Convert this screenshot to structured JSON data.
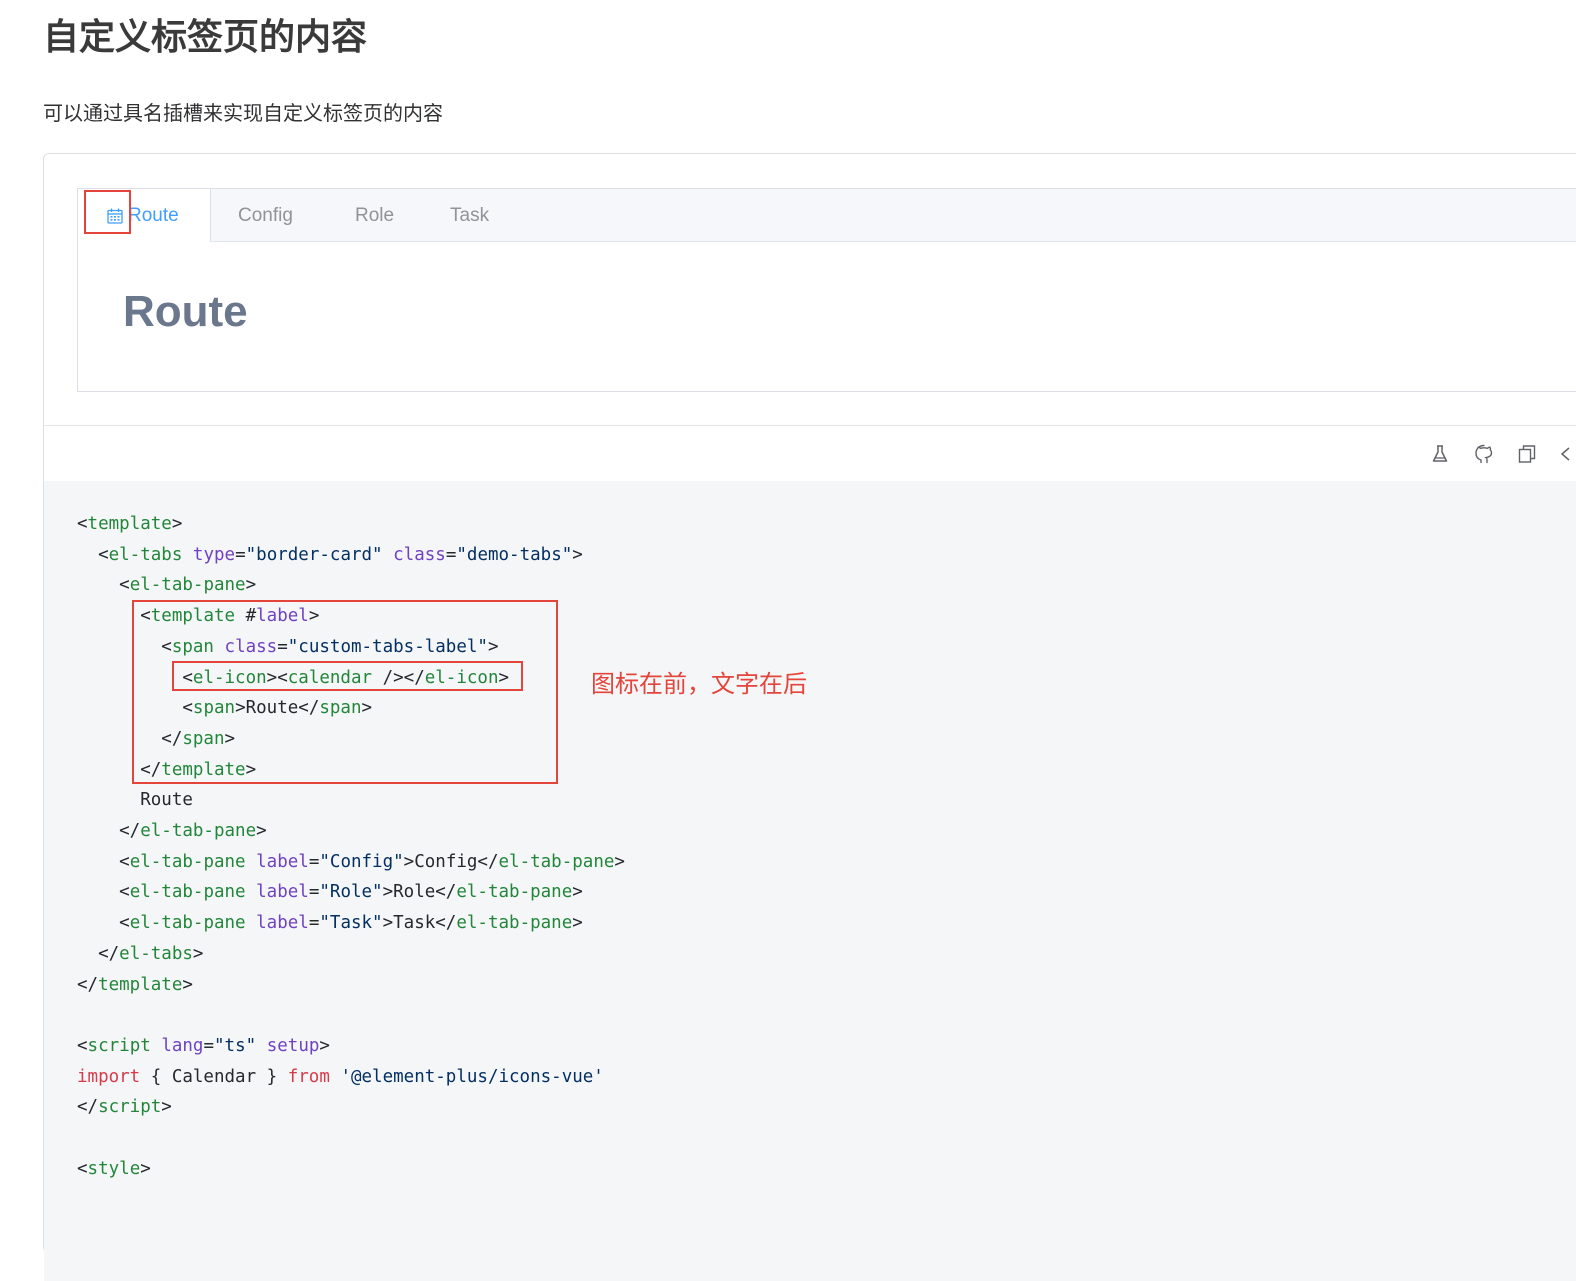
{
  "page": {
    "title": "自定义标签页的内容",
    "description": "可以通过具名插槽来实现自定义标签页的内容"
  },
  "tabs": {
    "items": [
      {
        "label": "Route",
        "active": true,
        "icon": "calendar-icon"
      },
      {
        "label": "Config",
        "active": false
      },
      {
        "label": "Role",
        "active": false
      },
      {
        "label": "Task",
        "active": false
      }
    ],
    "content": "Route"
  },
  "toolbar": {
    "icons": [
      "playground-flask-icon",
      "github-icon",
      "copy-icon",
      "code-toggle-icon"
    ]
  },
  "annotation": {
    "text": "图标在前，文字在后",
    "color": "#e5443a"
  },
  "code": {
    "lines": [
      [
        [
          "p",
          "<"
        ],
        [
          "t",
          "template"
        ],
        [
          "p",
          ">"
        ]
      ],
      [
        [
          "p",
          "  <"
        ],
        [
          "t",
          "el-tabs"
        ],
        [
          "p",
          " "
        ],
        [
          "a",
          "type"
        ],
        [
          "p",
          "="
        ],
        [
          "s",
          "\"border-card\""
        ],
        [
          "p",
          " "
        ],
        [
          "a",
          "class"
        ],
        [
          "p",
          "="
        ],
        [
          "s",
          "\"demo-tabs\""
        ],
        [
          "p",
          ">"
        ]
      ],
      [
        [
          "p",
          "    <"
        ],
        [
          "t",
          "el-tab-pane"
        ],
        [
          "p",
          ">"
        ]
      ],
      [
        [
          "p",
          "      <"
        ],
        [
          "t",
          "template"
        ],
        [
          "p",
          " #"
        ],
        [
          "a",
          "label"
        ],
        [
          "p",
          ">"
        ]
      ],
      [
        [
          "p",
          "        <"
        ],
        [
          "t",
          "span"
        ],
        [
          "p",
          " "
        ],
        [
          "a",
          "class"
        ],
        [
          "p",
          "="
        ],
        [
          "s",
          "\"custom-tabs-label\""
        ],
        [
          "p",
          ">"
        ]
      ],
      [
        [
          "p",
          "          <"
        ],
        [
          "t",
          "el-icon"
        ],
        [
          "p",
          "><"
        ],
        [
          "t",
          "calendar"
        ],
        [
          "p",
          " /></"
        ],
        [
          "t",
          "el-icon"
        ],
        [
          "p",
          ">"
        ]
      ],
      [
        [
          "p",
          "          <"
        ],
        [
          "t",
          "span"
        ],
        [
          "p",
          ">Route</"
        ],
        [
          "t",
          "span"
        ],
        [
          "p",
          ">"
        ]
      ],
      [
        [
          "p",
          "        </"
        ],
        [
          "t",
          "span"
        ],
        [
          "p",
          ">"
        ]
      ],
      [
        [
          "p",
          "      </"
        ],
        [
          "t",
          "template"
        ],
        [
          "p",
          ">"
        ]
      ],
      [
        [
          "p",
          "      Route"
        ]
      ],
      [
        [
          "p",
          "    </"
        ],
        [
          "t",
          "el-tab-pane"
        ],
        [
          "p",
          ">"
        ]
      ],
      [
        [
          "p",
          "    <"
        ],
        [
          "t",
          "el-tab-pane"
        ],
        [
          "p",
          " "
        ],
        [
          "a",
          "label"
        ],
        [
          "p",
          "="
        ],
        [
          "s",
          "\"Config\""
        ],
        [
          "p",
          ">Config</"
        ],
        [
          "t",
          "el-tab-pane"
        ],
        [
          "p",
          ">"
        ]
      ],
      [
        [
          "p",
          "    <"
        ],
        [
          "t",
          "el-tab-pane"
        ],
        [
          "p",
          " "
        ],
        [
          "a",
          "label"
        ],
        [
          "p",
          "="
        ],
        [
          "s",
          "\"Role\""
        ],
        [
          "p",
          ">Role</"
        ],
        [
          "t",
          "el-tab-pane"
        ],
        [
          "p",
          ">"
        ]
      ],
      [
        [
          "p",
          "    <"
        ],
        [
          "t",
          "el-tab-pane"
        ],
        [
          "p",
          " "
        ],
        [
          "a",
          "label"
        ],
        [
          "p",
          "="
        ],
        [
          "s",
          "\"Task\""
        ],
        [
          "p",
          ">Task</"
        ],
        [
          "t",
          "el-tab-pane"
        ],
        [
          "p",
          ">"
        ]
      ],
      [
        [
          "p",
          "  </"
        ],
        [
          "t",
          "el-tabs"
        ],
        [
          "p",
          ">"
        ]
      ],
      [
        [
          "p",
          "</"
        ],
        [
          "t",
          "template"
        ],
        [
          "p",
          ">"
        ]
      ],
      [
        [
          "p",
          ""
        ]
      ],
      [
        [
          "p",
          "<"
        ],
        [
          "t",
          "script"
        ],
        [
          "p",
          " "
        ],
        [
          "a",
          "lang"
        ],
        [
          "p",
          "="
        ],
        [
          "s",
          "\"ts\""
        ],
        [
          "p",
          " "
        ],
        [
          "a",
          "setup"
        ],
        [
          "p",
          ">"
        ]
      ],
      [
        [
          "k",
          "import"
        ],
        [
          "p",
          " { Calendar } "
        ],
        [
          "k",
          "from"
        ],
        [
          "p",
          " "
        ],
        [
          "s",
          "'@element-plus/icons-vue'"
        ]
      ],
      [
        [
          "p",
          "</"
        ],
        [
          "t",
          "script"
        ],
        [
          "p",
          ">"
        ]
      ],
      [
        [
          "p",
          ""
        ]
      ],
      [
        [
          "p",
          "<"
        ],
        [
          "t",
          "style"
        ],
        [
          "p",
          ">"
        ]
      ]
    ]
  },
  "colors": {
    "tag": "#22863a",
    "attr": "#6f42c1",
    "string": "#032f62",
    "keyword": "#d73a49",
    "accent": "#409eff",
    "highlight": "#e5443a"
  }
}
